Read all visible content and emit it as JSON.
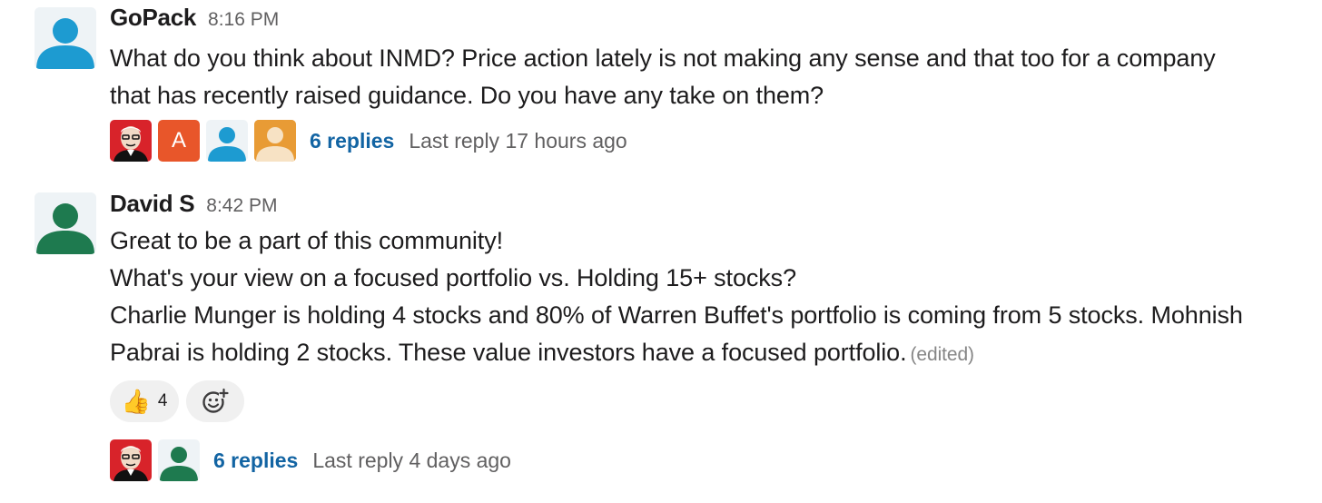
{
  "messages": [
    {
      "username": "GoPack",
      "time": "8:16 PM",
      "avatar_icon": "user-silhouette-blue",
      "avatar_color": "#1d9bd1",
      "lines": [
        "What do you think about INMD? Price action lately is not making any sense and that too for a company",
        "that has recently raised guidance. Do you have any take on them?"
      ],
      "thread": {
        "avatars": [
          "buffett-portrait-icon",
          "letter-a-avatar",
          "user-silhouette-blue",
          "user-silhouette-orange"
        ],
        "avatar_letter": "A",
        "replies_label": "6 replies",
        "last_reply": "Last reply 17 hours ago"
      }
    },
    {
      "username": "David S",
      "time": "8:42 PM",
      "avatar_icon": "user-silhouette-green",
      "avatar_color": "#1e7a4f",
      "lines": [
        "Great to be a part of this community!",
        "What's your view on a focused portfolio vs. Holding 15+ stocks?",
        "Charlie Munger is holding 4 stocks and 80% of Warren Buffet's portfolio is coming from 5 stocks. Mohnish",
        "Pabrai is holding 2 stocks. These value investors have a focused portfolio."
      ],
      "edited_label": "(edited)",
      "reactions": [
        {
          "emoji": "👍",
          "count": "4"
        }
      ],
      "add_reaction_icon": "add-reaction-icon",
      "thread": {
        "avatars": [
          "buffett-portrait-icon",
          "user-silhouette-green"
        ],
        "replies_label": "6 replies",
        "last_reply": "Last reply 4 days ago"
      }
    }
  ],
  "colors": {
    "link": "#1264a3",
    "muted": "#616061",
    "reaction_bg": "#f0f0f0"
  }
}
